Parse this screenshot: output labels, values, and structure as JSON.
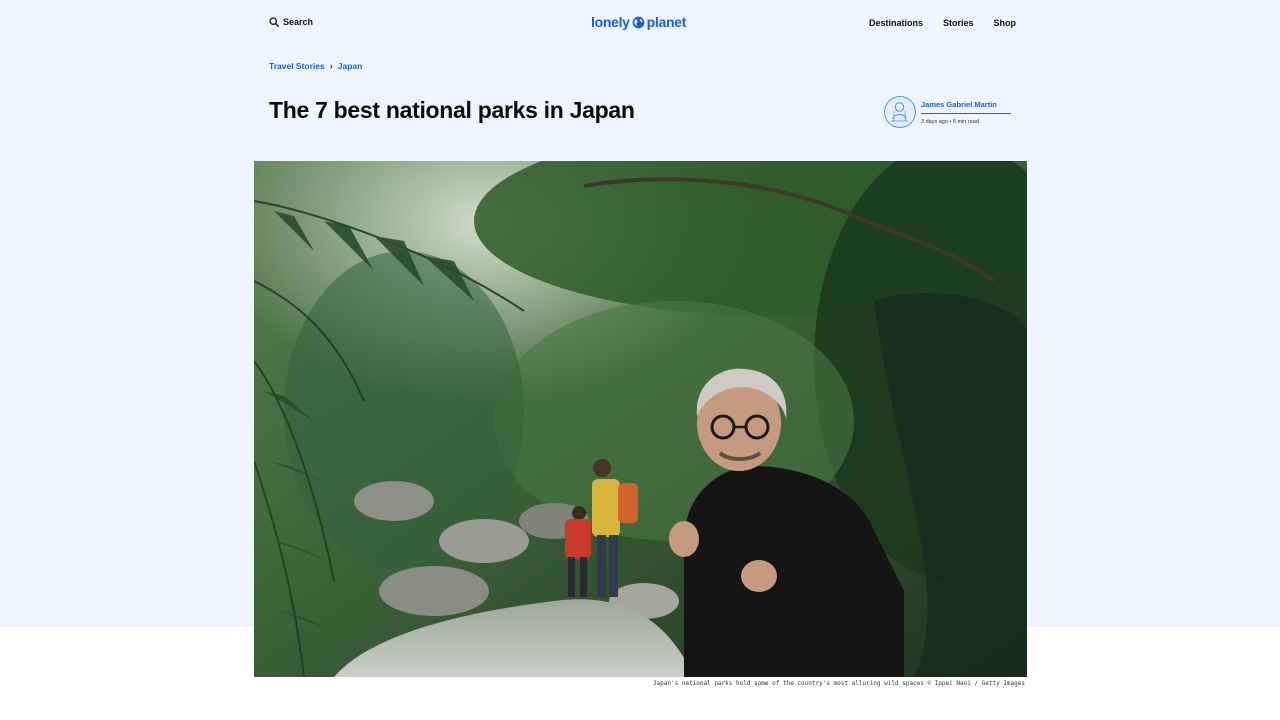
{
  "header": {
    "search_label": "Search",
    "logo_left": "lonely",
    "logo_right": "planet",
    "nav": [
      "Destinations",
      "Stories",
      "Shop"
    ],
    "accent_color": "#1a5fd0"
  },
  "breadcrumb": {
    "items": [
      "Travel Stories",
      "Japan"
    ],
    "separator": "›"
  },
  "article": {
    "title": "The 7 best national parks in Japan",
    "author": "James Gabriel Martin",
    "meta": "3 days ago • 6 min read"
  },
  "hero": {
    "caption": "Japan's national parks hold some of the country's most alluring wild spaces © Ippei Naoi / Getty Images"
  }
}
